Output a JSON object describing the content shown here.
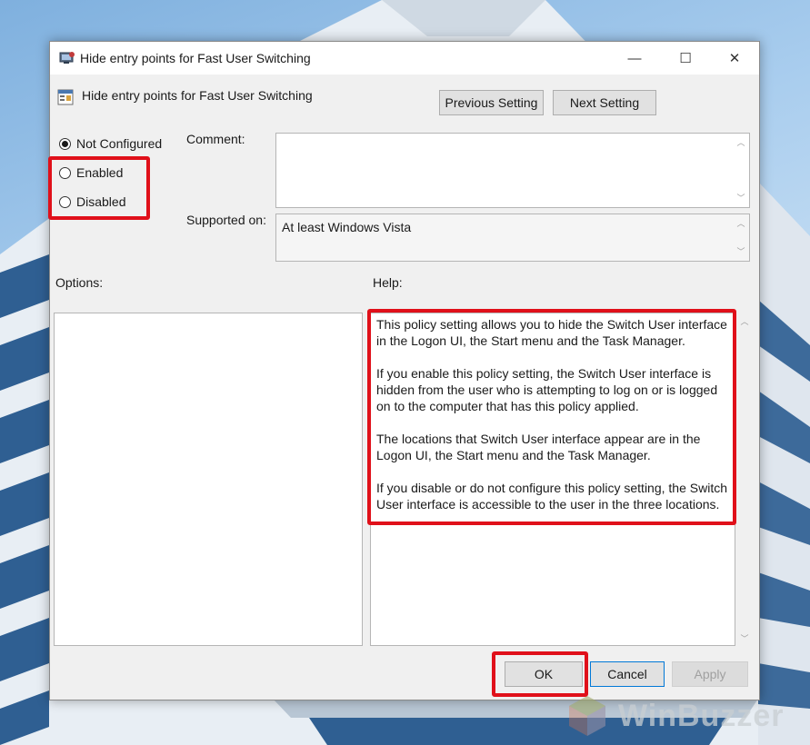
{
  "window": {
    "title": "Hide entry points for Fast User Switching",
    "minimize_glyph": "—",
    "maximize_glyph": "☐",
    "close_glyph": "✕"
  },
  "policy": {
    "name": "Hide entry points for Fast User Switching"
  },
  "nav": {
    "previous_label": "Previous Setting",
    "next_label": "Next Setting"
  },
  "state": {
    "selected": "not_configured",
    "options": [
      {
        "id": "not_configured",
        "label": "Not Configured"
      },
      {
        "id": "enabled",
        "label": "Enabled"
      },
      {
        "id": "disabled",
        "label": "Disabled"
      }
    ]
  },
  "comment": {
    "label": "Comment:",
    "value": ""
  },
  "supported": {
    "label": "Supported on:",
    "value": "At least Windows Vista"
  },
  "options_panel": {
    "label": "Options:"
  },
  "help_panel": {
    "label": "Help:",
    "paragraphs": [
      "This policy setting allows you to hide the Switch User interface in the Logon UI, the Start menu and the Task Manager.",
      "If you enable this policy setting, the Switch User interface is hidden from the user who is attempting to log on or is logged on to the computer that has this policy applied.",
      "The locations that Switch User interface appear are in the Logon UI, the Start menu and the Task Manager.",
      "If you disable or do not configure this policy setting, the Switch User interface is accessible to the user in the three locations."
    ]
  },
  "footer": {
    "ok_label": "OK",
    "cancel_label": "Cancel",
    "apply_label": "Apply"
  },
  "watermark": {
    "text": "WinBuzzer"
  },
  "colors": {
    "highlight": "#e0101a",
    "focus_border": "#0078d7"
  },
  "icons": {
    "app": "group-policy-editor-icon",
    "policy": "policy-setting-icon",
    "scroll_up": "chevron-up-icon",
    "scroll_down": "chevron-down-icon"
  }
}
